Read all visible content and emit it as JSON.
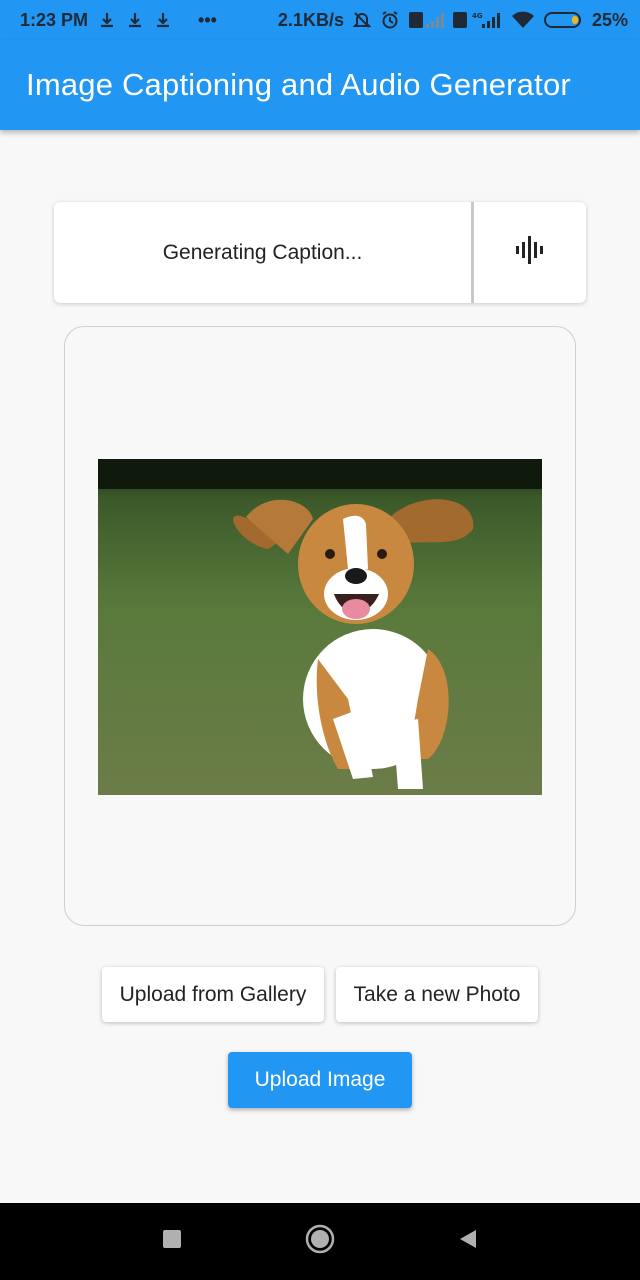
{
  "status_bar": {
    "time": "1:23 PM",
    "dots": "•••",
    "network_speed": "2.1KB/s",
    "battery": "25%",
    "network_type": "4G"
  },
  "app_bar": {
    "title": "Image Captioning and Audio Generator",
    "color": "#2196f3"
  },
  "caption": {
    "text": "Generating Caption..."
  },
  "buttons": {
    "gallery": "Upload from Gallery",
    "take_photo": "Take a new Photo",
    "upload": "Upload Image"
  },
  "icons": {
    "audio": "audio-wave-icon",
    "nav_recent": "square-icon",
    "nav_home": "circle-icon",
    "nav_back": "triangle-back-icon"
  }
}
